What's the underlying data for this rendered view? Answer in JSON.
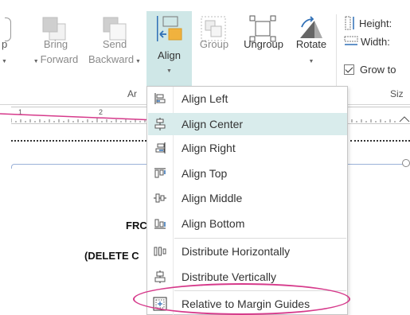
{
  "ribbon": {
    "partial_left": {
      "label1": "p",
      "label2": ""
    },
    "bring_forward": {
      "label1": "Bring",
      "label2": "Forward"
    },
    "send_backward": {
      "label1": "Send",
      "label2": "Backward"
    },
    "align": {
      "label1": "Align",
      "icon": "align-icon"
    },
    "group": {
      "label1": "Group"
    },
    "ungroup": {
      "label1": "Ungroup"
    },
    "rotate": {
      "label1": "Rotate"
    },
    "arrange_group_label": "Ar",
    "size_group_label": "Siz",
    "height_label": "Height:",
    "width_label": "Width:",
    "grow_label": "Grow to"
  },
  "ruler": {
    "numbers": [
      "1",
      "2"
    ]
  },
  "document": {
    "line1": "FRC",
    "line2": "(DELETE C"
  },
  "menu": {
    "items": [
      {
        "label": "Align Left",
        "icon": "align-left-icon"
      },
      {
        "label": "Align Center",
        "icon": "align-center-icon"
      },
      {
        "label": "Align Right",
        "icon": "align-right-icon"
      },
      {
        "label": "Align Top",
        "icon": "align-top-icon"
      },
      {
        "label": "Align Middle",
        "icon": "align-middle-icon"
      },
      {
        "label": "Align Bottom",
        "icon": "align-bottom-icon"
      },
      {
        "label": "Distribute Horizontally",
        "icon": "distribute-horizontally-icon"
      },
      {
        "label": "Distribute Vertically",
        "icon": "distribute-vertically-icon"
      },
      {
        "label": "Relative to Margin Guides",
        "icon": "margin-guides-icon"
      }
    ],
    "highlighted_index": 1
  },
  "colors": {
    "accent": "#d63a8b",
    "highlight": "#d9ecec",
    "align_button": "#cfe7e7"
  }
}
